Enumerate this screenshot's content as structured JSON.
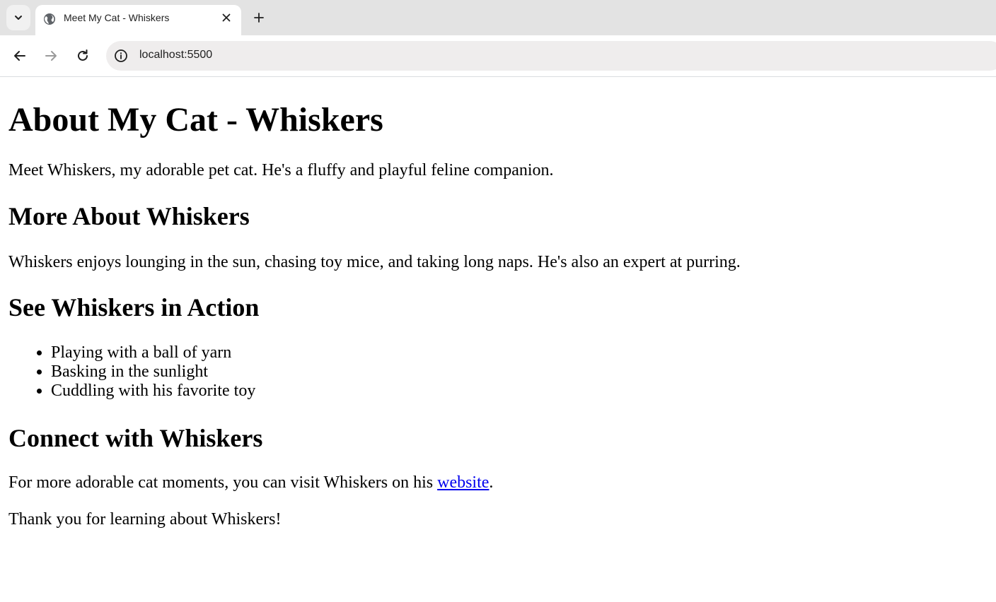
{
  "browser": {
    "tab": {
      "title": "Meet My Cat - Whiskers"
    },
    "address_bar": {
      "url": "localhost:5500"
    },
    "icons": {
      "tab_list": "chevron-down-icon",
      "favicon": "globe-icon",
      "close": "close-icon",
      "new_tab": "plus-icon",
      "back": "arrow-left-icon",
      "forward": "arrow-right-icon",
      "reload": "reload-icon",
      "site_info": "info-icon"
    }
  },
  "page": {
    "title": "About My Cat - Whiskers",
    "intro": "Meet Whiskers, my adorable pet cat. He's a fluffy and playful feline companion.",
    "more_heading": "More About Whiskers",
    "more_text": "Whiskers enjoys lounging in the sun, chasing toy mice, and taking long naps. He's also an expert at purring.",
    "action_heading": "See Whiskers in Action",
    "action_items": [
      "Playing with a ball of yarn",
      "Basking in the sunlight",
      "Cuddling with his favorite toy"
    ],
    "connect_heading": "Connect with Whiskers",
    "connect_text_before": "For more adorable cat moments, you can visit Whiskers on his ",
    "connect_link": "website",
    "connect_text_after": ".",
    "thanks": "Thank you for learning about Whiskers!",
    "link_color": "#0000ee"
  }
}
